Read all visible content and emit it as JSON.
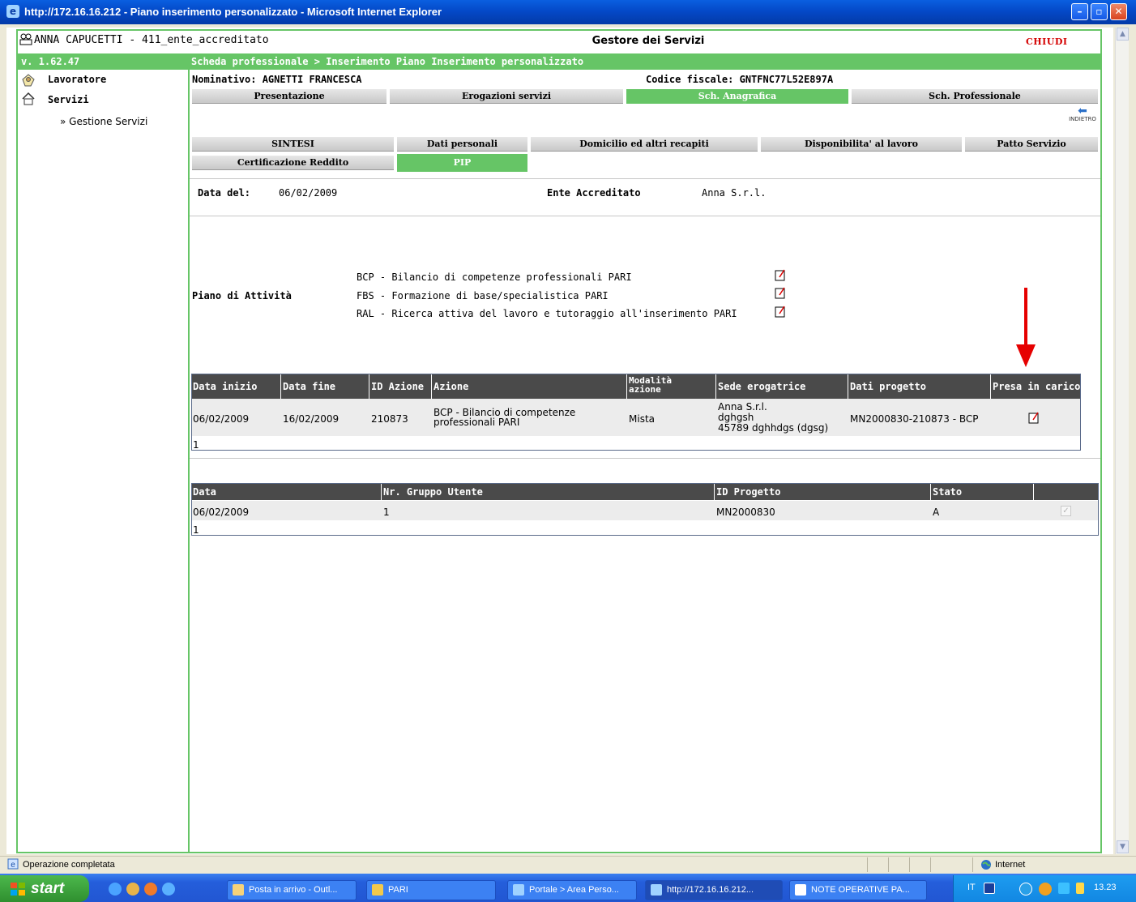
{
  "window": {
    "title": "http://172.16.16.212 - Piano inserimento personalizzato - Microsoft Internet Explorer"
  },
  "app": {
    "user": "ANNA CAPUCETTI - 411_ente_accreditato",
    "title": "Gestore dei Servizi",
    "close_label": "CHIUDI",
    "version": "v. 1.62.47",
    "breadcrumb": "Scheda professionale > Inserimento Piano Inserimento personalizzato"
  },
  "sidebar": {
    "items": [
      {
        "label": "Lavoratore"
      },
      {
        "label": "Servizi"
      }
    ],
    "sub_item": "» Gestione Servizi"
  },
  "worker": {
    "name": "Nominativo: AGNETTI  FRANCESCA",
    "tax_code": "Codice fiscale: GNTFNC77L52E897A"
  },
  "main_tabs": [
    {
      "label": "Presentazione",
      "active": false
    },
    {
      "label": "Erogazioni servizi",
      "active": false
    },
    {
      "label": "Sch. Anagrafica",
      "active": true
    },
    {
      "label": "Sch. Professionale",
      "active": false
    }
  ],
  "back_label": "INDIETRO",
  "sub_tabs": [
    {
      "label": "SINTESI",
      "active": false
    },
    {
      "label": "Dati personali",
      "active": false
    },
    {
      "label": "Domicilio ed altri recapiti",
      "active": false
    },
    {
      "label": "Disponibilita' al lavoro",
      "active": false
    },
    {
      "label": "Patto Servizio",
      "active": false
    },
    {
      "label": "Certificazione Reddito",
      "active": false
    },
    {
      "label": "PIP",
      "active": true
    }
  ],
  "info": {
    "date_label": "Data del:",
    "date_value": "06/02/2009",
    "ente_label": "Ente Accreditato",
    "ente_value": "Anna S.r.l."
  },
  "activity_plan": {
    "label": "Piano di Attività",
    "items": [
      "BCP - Bilancio di competenze professionali PARI",
      "FBS - Formazione di base/specialistica PARI",
      "RAL - Ricerca attiva del lavoro e tutoraggio all'inserimento PARI"
    ]
  },
  "actions_table": {
    "headers": [
      "Data inizio",
      "Data fine",
      "ID Azione",
      "Azione",
      "Modalità azione",
      "Sede erogatrice",
      "Dati progetto",
      "Presa in carico"
    ],
    "rows": [
      {
        "data_inizio": "06/02/2009",
        "data_fine": "16/02/2009",
        "id_azione": "210873",
        "azione": "BCP - Bilancio di competenze professionali PARI",
        "modalita": "Mista",
        "sede_line1": "Anna S.r.l.",
        "sede_line2": "dghgsh",
        "sede_line3": "45789 dghhdgs (dgsg)",
        "dati_progetto": "MN2000830-210873 - BCP"
      }
    ],
    "count": "1"
  },
  "groups_table": {
    "headers": [
      "Data",
      "Nr. Gruppo Utente",
      "ID Progetto",
      "Stato"
    ],
    "rows": [
      {
        "data": "06/02/2009",
        "gruppo": "1",
        "id_progetto": "MN2000830",
        "stato": "A"
      }
    ],
    "count": "1"
  },
  "statusbar": {
    "text": "Operazione completata",
    "zone": "Internet"
  },
  "taskbar": {
    "start_label": "start",
    "tasks": [
      {
        "label": "Posta in arrivo - Outl...",
        "active": false
      },
      {
        "label": "PARI",
        "active": false
      },
      {
        "label": "Portale > Area Perso...",
        "active": false
      },
      {
        "label": "http://172.16.16.212...",
        "active": true
      },
      {
        "label": "NOTE OPERATIVE PA...",
        "active": false
      }
    ],
    "lang": "IT",
    "clock": "13.23"
  },
  "colors": {
    "accent_green": "#66c566",
    "header_dark": "#4a4a4a",
    "close_red": "#d40000",
    "annotation_arrow": "#e60000"
  }
}
